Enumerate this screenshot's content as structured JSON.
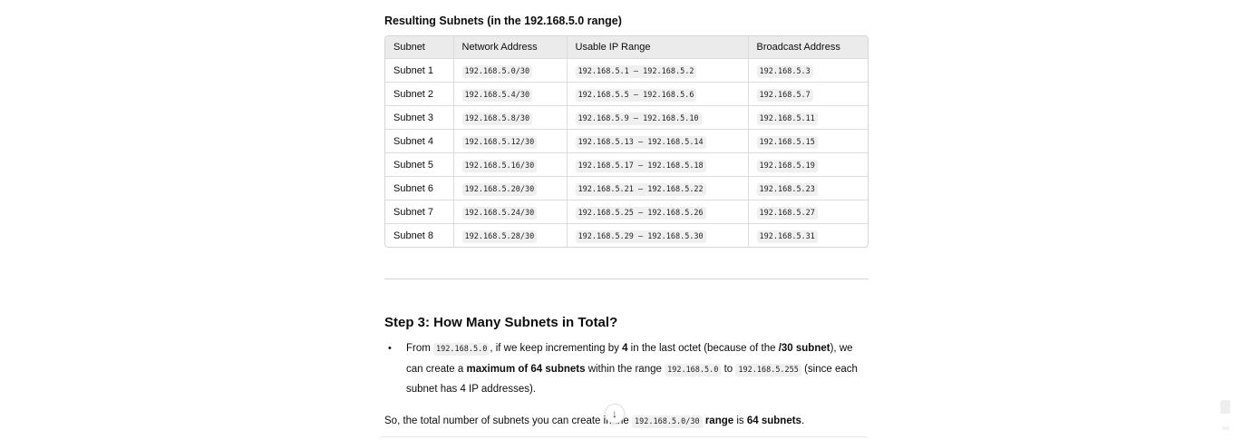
{
  "resulting_subnets": {
    "heading": "Resulting Subnets (in the 192.168.5.0 range)",
    "columns": [
      "Subnet",
      "Network Address",
      "Usable IP Range",
      "Broadcast Address"
    ],
    "rows": [
      {
        "subnet": "Subnet 1",
        "network": "192.168.5.0/30",
        "usable": "192.168.5.1 – 192.168.5.2",
        "broadcast": "192.168.5.3"
      },
      {
        "subnet": "Subnet 2",
        "network": "192.168.5.4/30",
        "usable": "192.168.5.5 – 192.168.5.6",
        "broadcast": "192.168.5.7"
      },
      {
        "subnet": "Subnet 3",
        "network": "192.168.5.8/30",
        "usable": "192.168.5.9 – 192.168.5.10",
        "broadcast": "192.168.5.11"
      },
      {
        "subnet": "Subnet 4",
        "network": "192.168.5.12/30",
        "usable": "192.168.5.13 – 192.168.5.14",
        "broadcast": "192.168.5.15"
      },
      {
        "subnet": "Subnet 5",
        "network": "192.168.5.16/30",
        "usable": "192.168.5.17 – 192.168.5.18",
        "broadcast": "192.168.5.19"
      },
      {
        "subnet": "Subnet 6",
        "network": "192.168.5.20/30",
        "usable": "192.168.5.21 – 192.168.5.22",
        "broadcast": "192.168.5.23"
      },
      {
        "subnet": "Subnet 7",
        "network": "192.168.5.24/30",
        "usable": "192.168.5.25 – 192.168.5.26",
        "broadcast": "192.168.5.27"
      },
      {
        "subnet": "Subnet 8",
        "network": "192.168.5.28/30",
        "usable": "192.168.5.29 – 192.168.5.30",
        "broadcast": "192.168.5.31"
      }
    ]
  },
  "step3": {
    "heading": "Step 3: How Many Subnets in Total?",
    "bullet": {
      "p1": "From ",
      "code1": "192.168.5.0",
      "p2": ", if we keep incrementing by ",
      "b1": "4",
      "p3": " in the last octet (because of the ",
      "b2": "/30 subnet",
      "p4": "), we can create a ",
      "b3": "maximum of 64 subnets",
      "p5": " within the range ",
      "code2": "192.168.5.0",
      "p6": " to ",
      "code3": "192.168.5.255",
      "p7": " (since each subnet has 4 IP addresses)."
    },
    "summary": {
      "p1": "So, the total number of subnets you can create in the ",
      "code": "192.168.5.0/30",
      "b1": " range",
      "p2": " is ",
      "b2": "64 subnets",
      "p3": "."
    }
  },
  "icons": {
    "bullet": "•",
    "scroll_down": "↓"
  }
}
